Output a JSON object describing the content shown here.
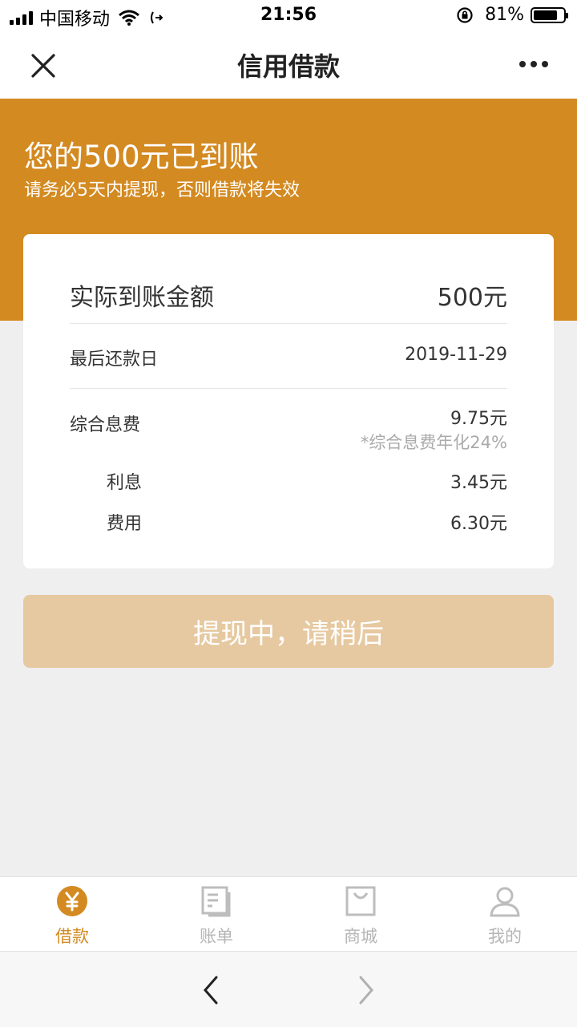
{
  "status_bar": {
    "carrier": "中国移动",
    "time": "21:56",
    "battery": "81%",
    "battery_level": 0.81
  },
  "navbar": {
    "title": "信用借款"
  },
  "banner": {
    "title": "您的500元已到账",
    "subtitle": "请务必5天内提现，否则借款将失效"
  },
  "summary": {
    "received": {
      "label": "实际到账金额",
      "value": "500元"
    },
    "due_date": {
      "label": "最后还款日",
      "value": "2019-11-29"
    },
    "total_fee": {
      "label": "综合息费",
      "value": "9.75元",
      "note": "*综合息费年化24%"
    },
    "interest": {
      "label": "利息",
      "value": "3.45元"
    },
    "fee": {
      "label": "费用",
      "value": "6.30元"
    }
  },
  "withdraw_button": {
    "label": "提现中，请稍后"
  },
  "tabs": [
    {
      "label": "借款",
      "icon": "yen-icon",
      "active": true
    },
    {
      "label": "账单",
      "icon": "bill-icon",
      "active": false
    },
    {
      "label": "商城",
      "icon": "shopping-bag-icon",
      "active": false
    },
    {
      "label": "我的",
      "icon": "user-icon",
      "active": false
    }
  ],
  "colors": {
    "accent": "#d38a21",
    "button_disabled": "#e6c9a1",
    "background": "#efefef"
  }
}
